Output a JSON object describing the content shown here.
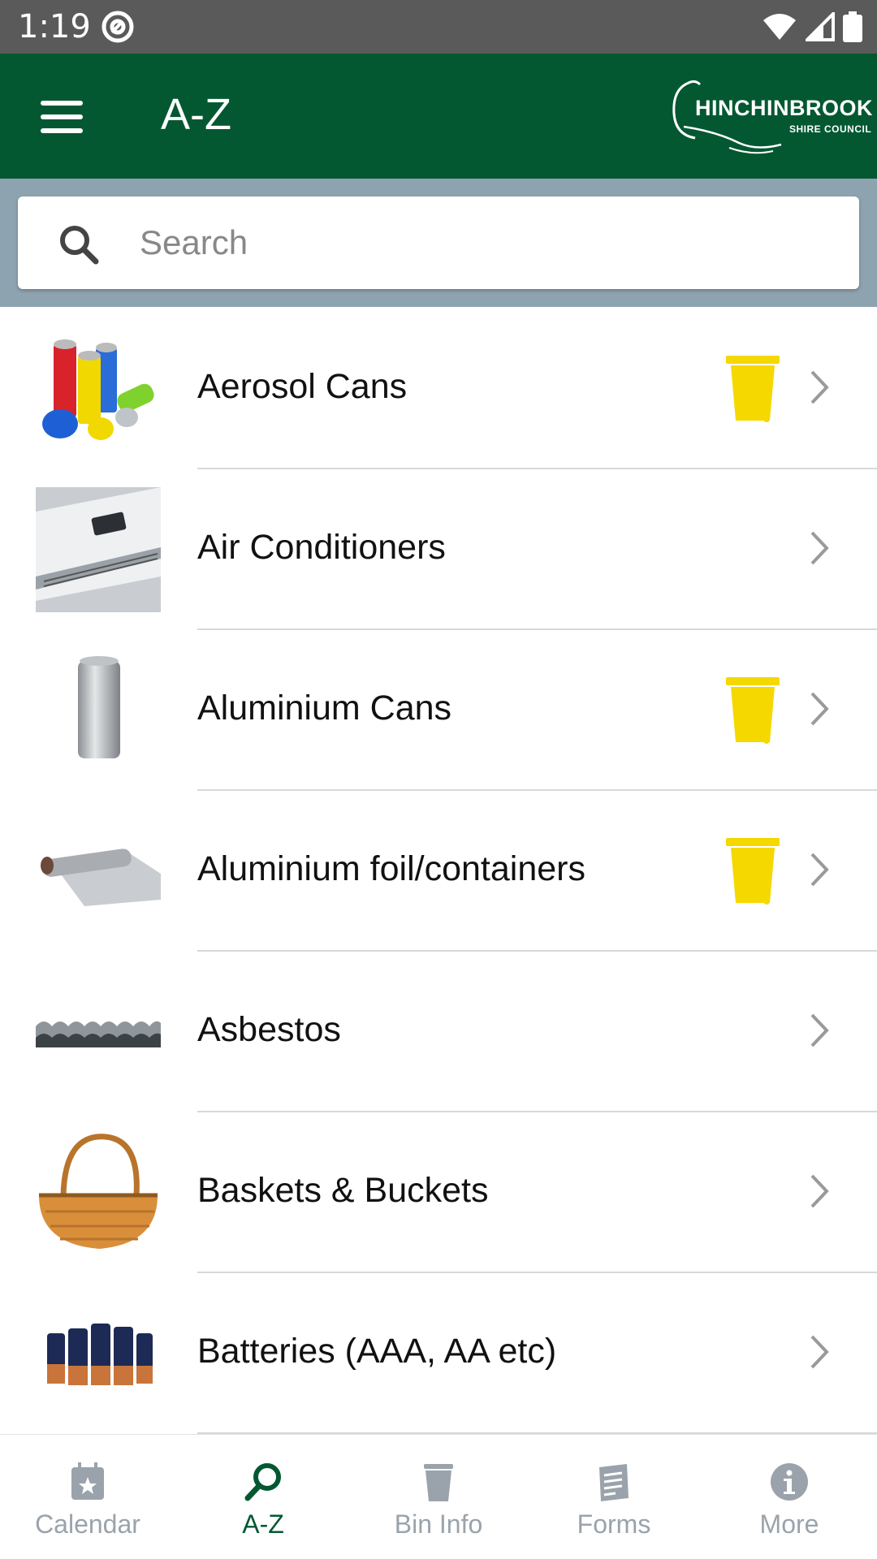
{
  "status_bar": {
    "time": "1:19"
  },
  "app_bar": {
    "title": "A-Z",
    "logo": {
      "line1": "HINCHINBROOK",
      "line2": "SHIRE COUNCIL"
    }
  },
  "search": {
    "placeholder": "Search",
    "value": ""
  },
  "items": [
    {
      "label": "Aerosol Cans",
      "yellow_bin": true,
      "thumb": "aerosol-cans"
    },
    {
      "label": "Air Conditioners",
      "yellow_bin": false,
      "thumb": "air-conditioner"
    },
    {
      "label": "Aluminium Cans",
      "yellow_bin": true,
      "thumb": "aluminium-can"
    },
    {
      "label": "Aluminium foil/containers",
      "yellow_bin": true,
      "thumb": "aluminium-foil"
    },
    {
      "label": "Asbestos",
      "yellow_bin": false,
      "thumb": "asbestos"
    },
    {
      "label": "Baskets & Buckets",
      "yellow_bin": false,
      "thumb": "basket"
    },
    {
      "label": "Batteries (AAA, AA etc)",
      "yellow_bin": false,
      "thumb": "batteries"
    }
  ],
  "bottom_nav": [
    {
      "label": "Calendar",
      "icon": "calendar-icon",
      "active": false
    },
    {
      "label": "A-Z",
      "icon": "search-icon",
      "active": true
    },
    {
      "label": "Bin Info",
      "icon": "bin-icon",
      "active": false
    },
    {
      "label": "Forms",
      "icon": "document-icon",
      "active": false
    },
    {
      "label": "More",
      "icon": "info-icon",
      "active": false
    }
  ],
  "colors": {
    "app_bar": "#035832",
    "status_bar": "#5a5a5a",
    "search_area": "#8ea3b0",
    "yellow_bin": "#f5d800",
    "nav_active": "#035832",
    "nav_inactive": "#9aa3ab"
  }
}
